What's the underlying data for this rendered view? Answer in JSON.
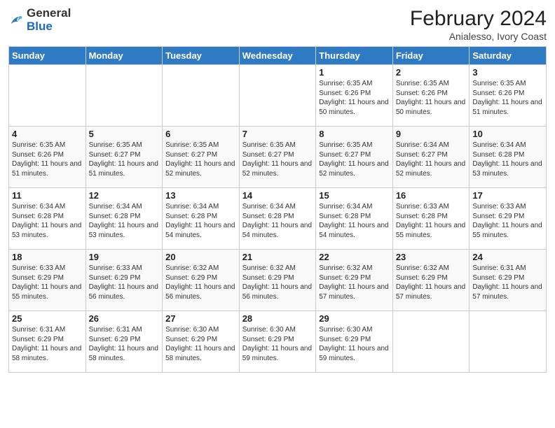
{
  "header": {
    "logo_general": "General",
    "logo_blue": "Blue",
    "month_year": "February 2024",
    "location": "Anialesso, Ivory Coast"
  },
  "days_of_week": [
    "Sunday",
    "Monday",
    "Tuesday",
    "Wednesday",
    "Thursday",
    "Friday",
    "Saturday"
  ],
  "weeks": [
    [
      {
        "day": "",
        "info": ""
      },
      {
        "day": "",
        "info": ""
      },
      {
        "day": "",
        "info": ""
      },
      {
        "day": "",
        "info": ""
      },
      {
        "day": "1",
        "info": "Sunrise: 6:35 AM\nSunset: 6:26 PM\nDaylight: 11 hours\nand 50 minutes."
      },
      {
        "day": "2",
        "info": "Sunrise: 6:35 AM\nSunset: 6:26 PM\nDaylight: 11 hours\nand 50 minutes."
      },
      {
        "day": "3",
        "info": "Sunrise: 6:35 AM\nSunset: 6:26 PM\nDaylight: 11 hours\nand 51 minutes."
      }
    ],
    [
      {
        "day": "4",
        "info": "Sunrise: 6:35 AM\nSunset: 6:26 PM\nDaylight: 11 hours\nand 51 minutes."
      },
      {
        "day": "5",
        "info": "Sunrise: 6:35 AM\nSunset: 6:27 PM\nDaylight: 11 hours\nand 51 minutes."
      },
      {
        "day": "6",
        "info": "Sunrise: 6:35 AM\nSunset: 6:27 PM\nDaylight: 11 hours\nand 52 minutes."
      },
      {
        "day": "7",
        "info": "Sunrise: 6:35 AM\nSunset: 6:27 PM\nDaylight: 11 hours\nand 52 minutes."
      },
      {
        "day": "8",
        "info": "Sunrise: 6:35 AM\nSunset: 6:27 PM\nDaylight: 11 hours\nand 52 minutes."
      },
      {
        "day": "9",
        "info": "Sunrise: 6:34 AM\nSunset: 6:27 PM\nDaylight: 11 hours\nand 52 minutes."
      },
      {
        "day": "10",
        "info": "Sunrise: 6:34 AM\nSunset: 6:28 PM\nDaylight: 11 hours\nand 53 minutes."
      }
    ],
    [
      {
        "day": "11",
        "info": "Sunrise: 6:34 AM\nSunset: 6:28 PM\nDaylight: 11 hours\nand 53 minutes."
      },
      {
        "day": "12",
        "info": "Sunrise: 6:34 AM\nSunset: 6:28 PM\nDaylight: 11 hours\nand 53 minutes."
      },
      {
        "day": "13",
        "info": "Sunrise: 6:34 AM\nSunset: 6:28 PM\nDaylight: 11 hours\nand 54 minutes."
      },
      {
        "day": "14",
        "info": "Sunrise: 6:34 AM\nSunset: 6:28 PM\nDaylight: 11 hours\nand 54 minutes."
      },
      {
        "day": "15",
        "info": "Sunrise: 6:34 AM\nSunset: 6:28 PM\nDaylight: 11 hours\nand 54 minutes."
      },
      {
        "day": "16",
        "info": "Sunrise: 6:33 AM\nSunset: 6:28 PM\nDaylight: 11 hours\nand 55 minutes."
      },
      {
        "day": "17",
        "info": "Sunrise: 6:33 AM\nSunset: 6:29 PM\nDaylight: 11 hours\nand 55 minutes."
      }
    ],
    [
      {
        "day": "18",
        "info": "Sunrise: 6:33 AM\nSunset: 6:29 PM\nDaylight: 11 hours\nand 55 minutes."
      },
      {
        "day": "19",
        "info": "Sunrise: 6:33 AM\nSunset: 6:29 PM\nDaylight: 11 hours\nand 56 minutes."
      },
      {
        "day": "20",
        "info": "Sunrise: 6:32 AM\nSunset: 6:29 PM\nDaylight: 11 hours\nand 56 minutes."
      },
      {
        "day": "21",
        "info": "Sunrise: 6:32 AM\nSunset: 6:29 PM\nDaylight: 11 hours\nand 56 minutes."
      },
      {
        "day": "22",
        "info": "Sunrise: 6:32 AM\nSunset: 6:29 PM\nDaylight: 11 hours\nand 57 minutes."
      },
      {
        "day": "23",
        "info": "Sunrise: 6:32 AM\nSunset: 6:29 PM\nDaylight: 11 hours\nand 57 minutes."
      },
      {
        "day": "24",
        "info": "Sunrise: 6:31 AM\nSunset: 6:29 PM\nDaylight: 11 hours\nand 57 minutes."
      }
    ],
    [
      {
        "day": "25",
        "info": "Sunrise: 6:31 AM\nSunset: 6:29 PM\nDaylight: 11 hours\nand 58 minutes."
      },
      {
        "day": "26",
        "info": "Sunrise: 6:31 AM\nSunset: 6:29 PM\nDaylight: 11 hours\nand 58 minutes."
      },
      {
        "day": "27",
        "info": "Sunrise: 6:30 AM\nSunset: 6:29 PM\nDaylight: 11 hours\nand 58 minutes."
      },
      {
        "day": "28",
        "info": "Sunrise: 6:30 AM\nSunset: 6:29 PM\nDaylight: 11 hours\nand 59 minutes."
      },
      {
        "day": "29",
        "info": "Sunrise: 6:30 AM\nSunset: 6:29 PM\nDaylight: 11 hours\nand 59 minutes."
      },
      {
        "day": "",
        "info": ""
      },
      {
        "day": "",
        "info": ""
      }
    ]
  ]
}
